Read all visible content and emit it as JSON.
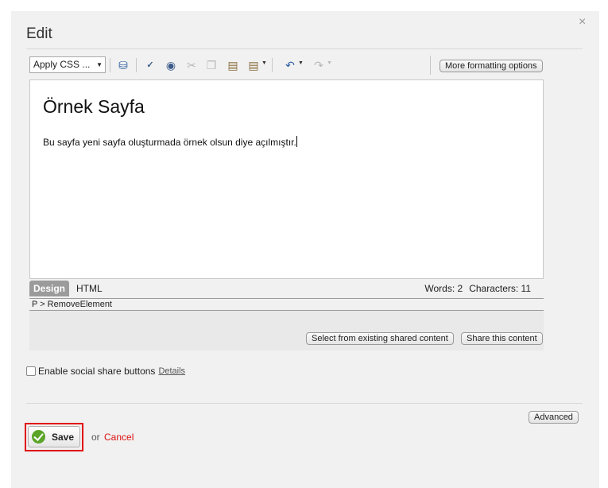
{
  "dialog": {
    "title": "Edit",
    "close_glyph": "×"
  },
  "toolbar": {
    "css_select_value": "Apply CSS ...",
    "more_formatting_label": "More formatting options",
    "icons": [
      "spell-check-icon",
      "find-icon",
      "cut-icon",
      "copy-icon",
      "paste-icon",
      "paste-special-icon",
      "undo-icon",
      "redo-icon",
      "insert-icon"
    ]
  },
  "editor": {
    "heading": "Örnek Sayfa",
    "body": "Bu sayfa yeni sayfa oluşturmada örnek olsun diye açılmıştır."
  },
  "modebar": {
    "tab_design": "Design",
    "tab_html": "HTML",
    "words": "Words: 2",
    "characters": "Characters: 11"
  },
  "path_bar": "P > RemoveElement",
  "shared": {
    "select_existing_label": "Select from existing shared content",
    "share_label": "Share this content"
  },
  "social": {
    "label": "Enable social share buttons",
    "details_link": "Details"
  },
  "advanced_label": "Advanced",
  "footer": {
    "save_label": "Save",
    "or_text": "or",
    "cancel_label": "Cancel"
  },
  "colors": {
    "cancel": "#dd1111",
    "save_check": "#5aa427",
    "highlight": "#e00000"
  }
}
